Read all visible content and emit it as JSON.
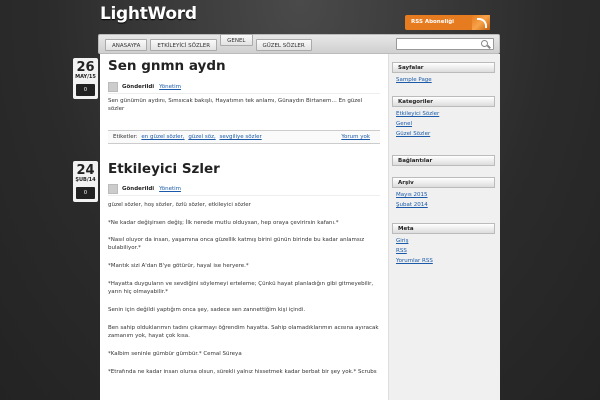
{
  "site": {
    "logo": "LightWord",
    "rss_label": "RSS Aboneliği"
  },
  "nav": {
    "items": [
      {
        "label": "ANASAYFA"
      },
      {
        "label": "ETKİLEYİCİ SÖZLER"
      },
      {
        "label": "GENEL"
      },
      {
        "label": "GÜZEL SÖZLER"
      }
    ],
    "search_value": ""
  },
  "posts": [
    {
      "day": "26",
      "month": "MAY/15",
      "comments": "0",
      "title": "Sen gnmn aydn",
      "author_label": "Gönderildi",
      "author": "Yönetim",
      "excerpt": "Sen günümün aydını, Sımsıcak bakışlı, Hayatımın tek anlamı, Günaydın Birtanem… En güzel sözler",
      "tags_label": "Etiketler:",
      "tags": [
        "en güzel sözler,",
        "güzel söz,",
        "sevgiliye sözler"
      ],
      "comments_link": "Yorum yok"
    },
    {
      "day": "24",
      "month": "ŞUB/14",
      "comments": "0",
      "title": "Etkileyici Szler",
      "author_label": "Gönderildi",
      "author": "Yönetim",
      "paragraphs": [
        "güzel sözler, hoş sözler,  özlü sözler,  etkileyici sözler",
        "*Ne kadar değişirsen değiş; İlk nerede mutlu olduysan, hep oraya çevirirsin kafanı.*",
        "*Nasıl oluyor da insan, yaşamına onca güzellik katmış birini günün birinde bu kadar anlamsız bulabiliyor.*",
        "*Mantık sizi A'dan B'ye götürür, hayal ise heryere.*",
        "*Hayatta duyguların ve sevdiğini söylemeyi erteleme; Çünkü hayat planladığın gibi gitmeyebilir, yarın hiç olmayabilir.*",
        "Senin için değildi yaptığım onca şey, sadece sen zannettiğim kişi içindi.",
        "Ben sahip olduklarımın tadını çıkarmayı öğrendim hayatta. Sahip olamadıklarımın acısına ayıracak zamanım yok, hayat çok kısa.",
        "*Kalbim seninle gümbür gümbür.* Cemal Süreya",
        "*Etrafında ne kadar insan olursa olsun, sürekli yalnız hissetmek kadar berbat bir şey yok.* Scrubs"
      ]
    }
  ],
  "sidebar": {
    "pages": {
      "title": "Sayfalar",
      "items": [
        "Sample Page"
      ]
    },
    "categories": {
      "title": "Kategoriler",
      "items": [
        "Etkileyici Sözler",
        "Genel",
        "Güzel Sözler"
      ]
    },
    "links": {
      "title": "Bağlantılar"
    },
    "archive": {
      "title": "Arşiv",
      "items": [
        "Mayıs 2015",
        "Şubat 2014"
      ]
    },
    "meta": {
      "title": "Meta",
      "items": [
        "Giriş",
        "RSS",
        "Yorumlar RSS"
      ]
    }
  },
  "colors": {
    "accent": "#e77b1f",
    "link": "#1a5aa8",
    "background": "#2a2a2a"
  }
}
